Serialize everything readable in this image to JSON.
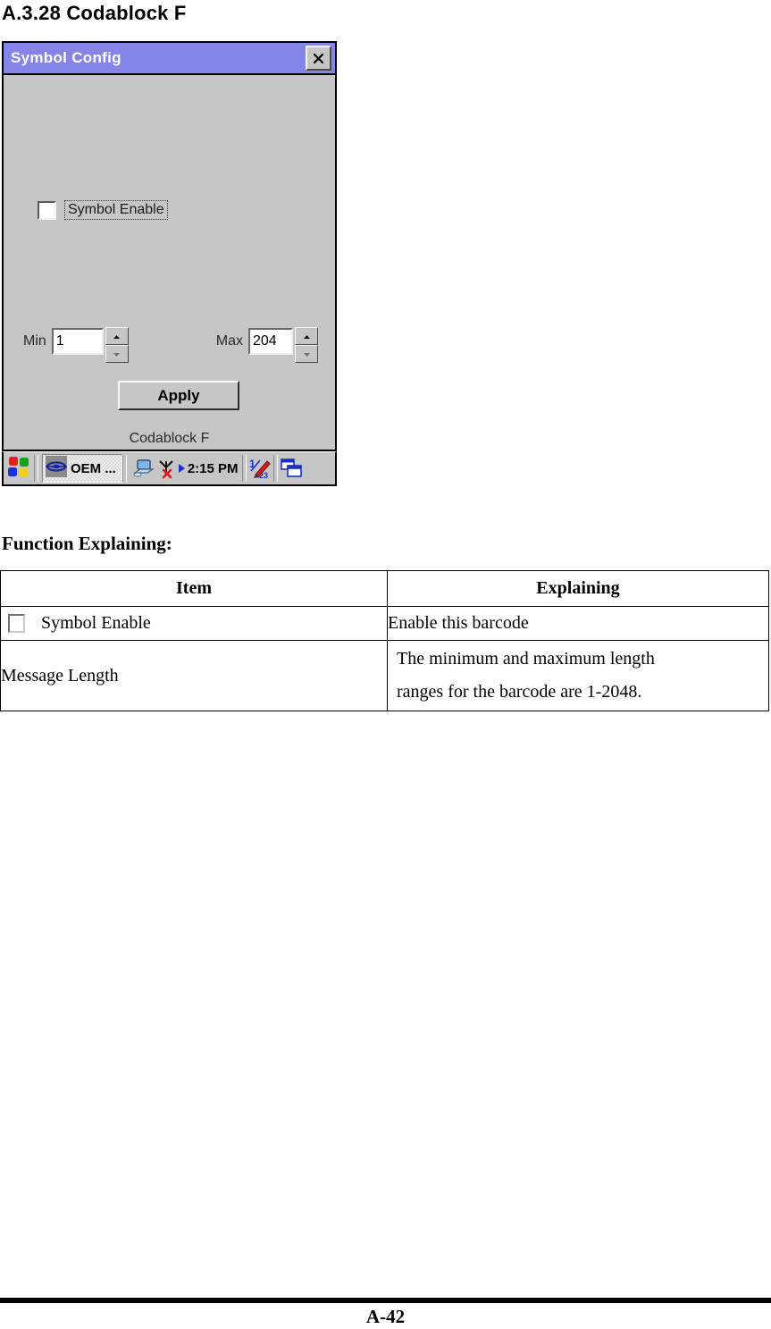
{
  "document": {
    "heading": "A.3.28 Codablock F",
    "section_label": "Function Explaining:",
    "footer_page": "A-42"
  },
  "device_screenshot": {
    "dialog": {
      "title": "Symbol Config",
      "close_icon": "close-icon",
      "symbol_enable": {
        "label": "Symbol Enable",
        "checked": false
      },
      "min_field": {
        "label": "Min",
        "value": "1",
        "spinner_up_icon": "spinner-up-icon",
        "spinner_down_icon": "spinner-down-icon"
      },
      "max_field": {
        "label": "Max",
        "value": "204",
        "spinner_up_icon": "spinner-up-icon",
        "spinner_down_icon": "spinner-down-icon"
      },
      "apply_label": "Apply",
      "caption": "Codablock F"
    },
    "taskbar": {
      "start_icon": "windows-start-flag-icon",
      "task_button": {
        "icon": "oem-app-icon",
        "label": "OEM ..."
      },
      "tray": {
        "desktop_icon": "desktop-pc-icon",
        "antenna_icon": "antenna-disconnected-icon",
        "arrow_icon": "blue-triangle-icon",
        "clock": "2:15 PM",
        "input_panel_icon": "input-panel-pen-icon",
        "window_switch_icon": "window-stack-icon"
      }
    }
  },
  "function_table": {
    "headers": [
      "Item",
      "Explaining"
    ],
    "rows": [
      {
        "has_checkbox": true,
        "item": "Symbol Enable",
        "explaining_lines": [
          "Enable this barcode"
        ]
      },
      {
        "has_checkbox": false,
        "item": "Message Length",
        "explaining_lines": [
          "The minimum and maximum length",
          "ranges for the barcode are 1-2048."
        ]
      }
    ]
  },
  "colors": {
    "titlebar": "#8585e8",
    "dialog_face": "#c6c6c6",
    "text": "#000000"
  }
}
